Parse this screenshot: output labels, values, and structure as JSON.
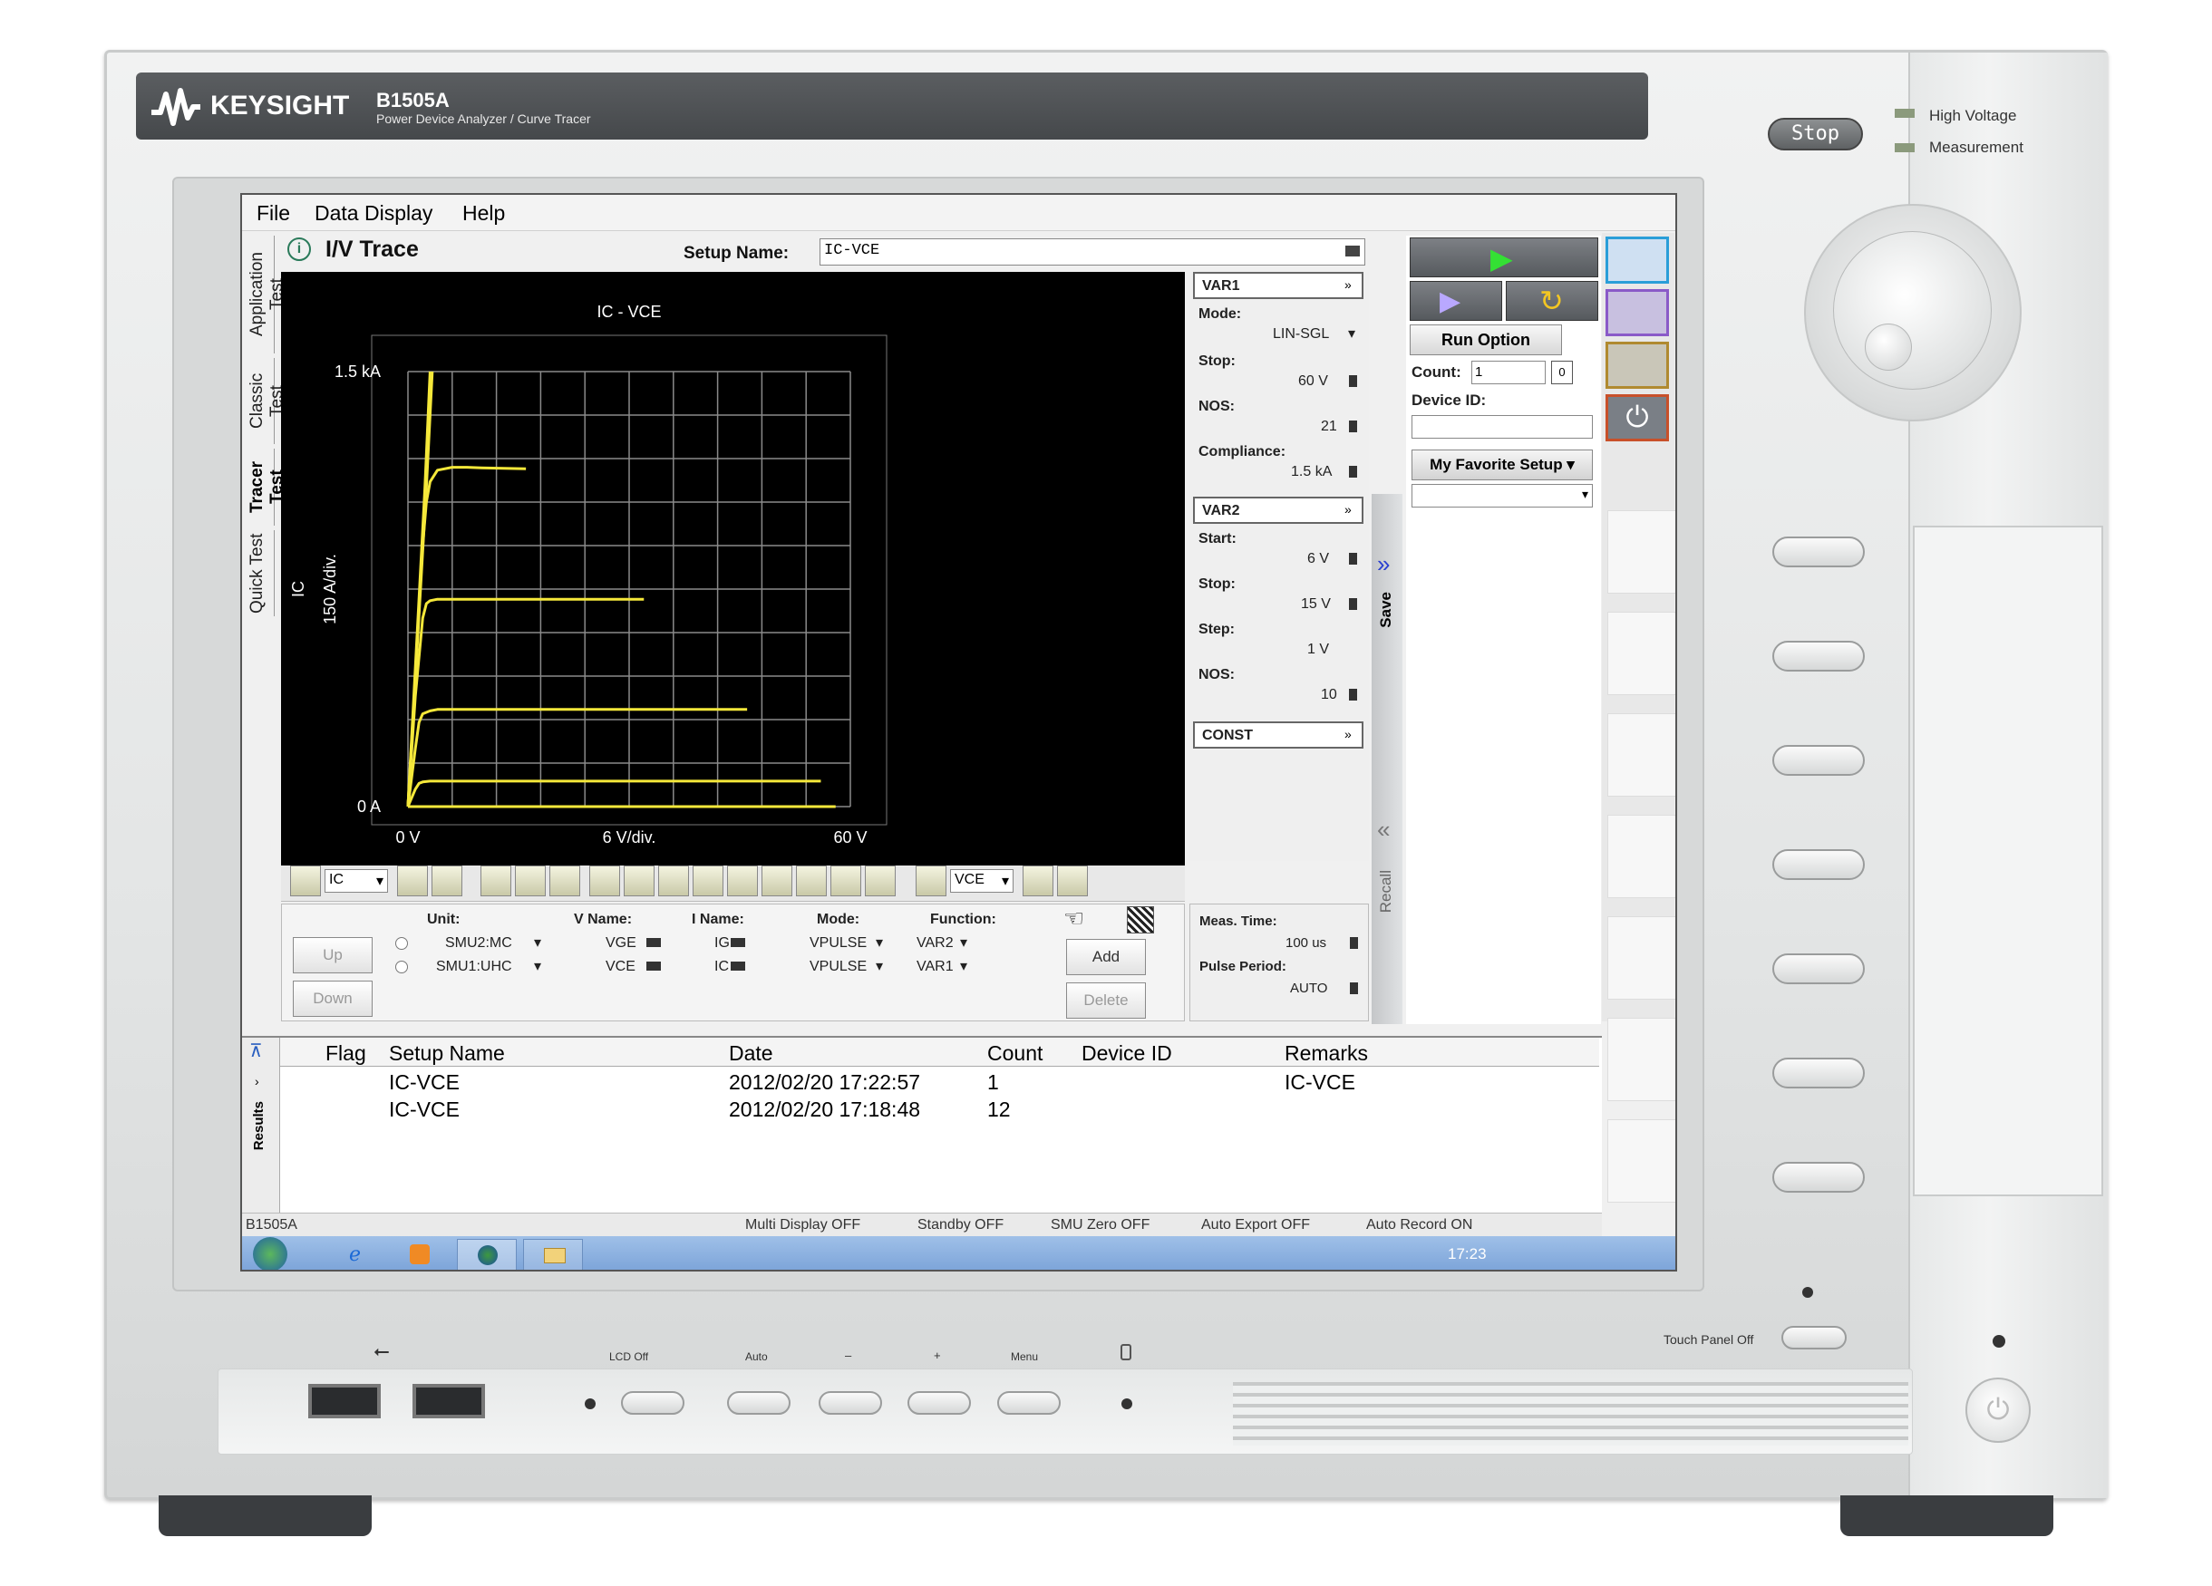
{
  "brand": {
    "name": "KEYSIGHT",
    "model": "B1505A",
    "subtitle": "Power Device Analyzer / Curve Tracer"
  },
  "front": {
    "stop_label": "Stop",
    "hv_line1": "High Voltage",
    "hv_line2": "Measurement",
    "touch_panel_off": "Touch Panel Off",
    "keys": {
      "lcd_off": "LCD Off",
      "auto": "Auto",
      "minus": "–",
      "plus": "+",
      "menu": "Menu"
    }
  },
  "menu": {
    "file": "File",
    "data_display": "Data Display",
    "help": "Help"
  },
  "tabs": {
    "application": "Application Test",
    "classic": "Classic Test",
    "tracer": "Tracer Test",
    "quick": "Quick Test"
  },
  "header": {
    "title": "I/V Trace",
    "setup_label": "Setup Name:",
    "setup_value": "IC-VCE"
  },
  "chart_data": {
    "type": "line",
    "title": "IC - VCE",
    "xlabel": "VCE",
    "ylabel": "IC",
    "x_ticks": [
      "0 V",
      "6 V/div.",
      "60 V"
    ],
    "y_ticks": [
      "1.5 kA",
      "150 A/div.",
      "0 A"
    ],
    "xlim": [
      0,
      60
    ],
    "ylim": [
      0,
      1500
    ],
    "grid": true,
    "line_color": "#f5e83a",
    "series": [
      {
        "x": [
          0,
          1,
          2,
          2.5,
          3,
          4,
          6,
          8,
          10,
          16
        ],
        "y": [
          0,
          450,
          900,
          1050,
          1120,
          1160,
          1170,
          1170,
          1168,
          1165
        ]
      },
      {
        "x": [
          0,
          1,
          2,
          2.5,
          3,
          4,
          8,
          16,
          24,
          32
        ],
        "y": [
          0,
          380,
          650,
          700,
          710,
          715,
          715,
          715,
          715,
          715
        ]
      },
      {
        "x": [
          0,
          1,
          1.5,
          2,
          3,
          4,
          12,
          24,
          36,
          46
        ],
        "y": [
          0,
          200,
          290,
          320,
          330,
          335,
          335,
          335,
          335,
          335
        ]
      },
      {
        "x": [
          0,
          1,
          1.5,
          2,
          3,
          6,
          20,
          40,
          56
        ],
        "y": [
          0,
          60,
          80,
          85,
          88,
          88,
          88,
          88,
          88
        ]
      },
      {
        "x": [
          0,
          10,
          30,
          58
        ],
        "y": [
          0,
          0,
          0,
          0
        ]
      },
      {
        "x": [
          0,
          2.5,
          3.3
        ],
        "y": [
          0,
          1100,
          1500
        ]
      },
      {
        "x": [
          0,
          2.3,
          3.0
        ],
        "y": [
          0,
          1100,
          1500
        ]
      }
    ]
  },
  "toolbar": {
    "y_axis": "IC",
    "x_axis": "VCE"
  },
  "var1": {
    "title": "VAR1",
    "mode_label": "Mode:",
    "mode": "LIN-SGL",
    "stop_label": "Stop:",
    "stop": "60 V",
    "nos_label": "NOS:",
    "nos": "21",
    "comp_label": "Compliance:",
    "comp": "1.5 kA"
  },
  "var2": {
    "title": "VAR2",
    "start_label": "Start:",
    "start": "6 V",
    "stop_label": "Stop:",
    "stop": "15 V",
    "step_label": "Step:",
    "step": "1 V",
    "nos_label": "NOS:",
    "nos": "10"
  },
  "const": {
    "title": "CONST"
  },
  "smu": {
    "headers": [
      "Unit:",
      "V Name:",
      "I Name:",
      "Mode:",
      "Function:"
    ],
    "rows": [
      {
        "unit": "SMU2:MC",
        "vname": "VGE",
        "iname": "IG",
        "mode": "VPULSE",
        "func": "VAR2"
      },
      {
        "unit": "SMU1:UHC",
        "vname": "VCE",
        "iname": "IC",
        "mode": "VPULSE",
        "func": "VAR1"
      }
    ],
    "up": "Up",
    "down": "Down",
    "add": "Add",
    "delete": "Delete"
  },
  "meas": {
    "time_label": "Meas. Time:",
    "time": "100 us",
    "period_label": "Pulse Period:",
    "period": "AUTO"
  },
  "side": {
    "save": "Save",
    "recall": "Recall",
    "run_option": "Run Option",
    "count_label": "Count:",
    "count": "1",
    "count_box": "0",
    "device_id_label": "Device ID:",
    "favorite": "My Favorite Setup"
  },
  "results": {
    "tab": "Results",
    "headers": [
      "Flag",
      "Setup Name",
      "Date",
      "Count",
      "Device ID",
      "Remarks"
    ],
    "rows": [
      {
        "flag": "",
        "setup": "IC-VCE",
        "date": "2012/02/20 17:22:57",
        "count": "1",
        "device": "",
        "remarks": "IC-VCE"
      },
      {
        "flag": "",
        "setup": "IC-VCE",
        "date": "2012/02/20 17:18:48",
        "count": "12",
        "device": "",
        "remarks": ""
      }
    ]
  },
  "status": {
    "left": "B1505A",
    "multi": "Multi Display OFF",
    "standby": "Standby OFF",
    "smu_zero": "SMU Zero OFF",
    "auto_export": "Auto Export OFF",
    "auto_record": "Auto Record ON"
  },
  "taskbar": {
    "time": "17:23"
  }
}
